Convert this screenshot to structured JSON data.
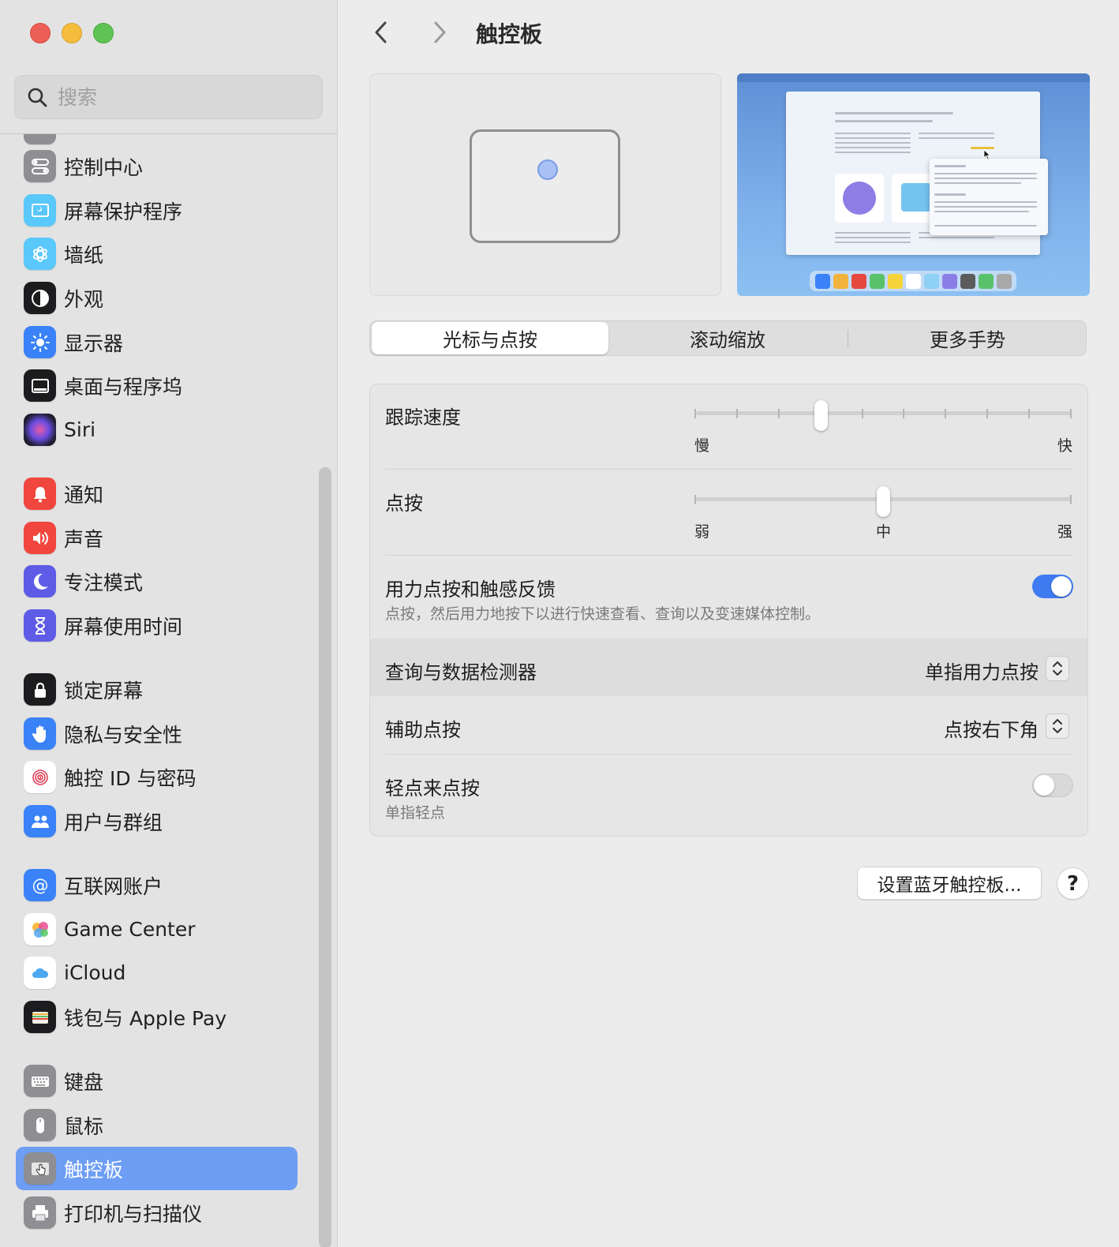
{
  "window": {
    "title": "触控板"
  },
  "sidebar": {
    "search_placeholder": "搜索",
    "items": [
      {
        "label": "控制中心",
        "icon": "control-center-icon",
        "color": "#8e8e93"
      },
      {
        "label": "屏幕保护程序",
        "icon": "screensaver-icon",
        "color": "#5ac8fa"
      },
      {
        "label": "墙纸",
        "icon": "wallpaper-icon",
        "color": "#5ac8fa"
      },
      {
        "label": "外观",
        "icon": "appearance-icon",
        "color": "#1c1c1e"
      },
      {
        "label": "显示器",
        "icon": "displays-icon",
        "color": "#3a82f7"
      },
      {
        "label": "桌面与程序坞",
        "icon": "desktop-dock-icon",
        "color": "#1c1c1e"
      },
      {
        "label": "Siri",
        "icon": "siri-icon",
        "color": "#2c2c3e"
      },
      {
        "label": "通知",
        "icon": "notifications-icon",
        "color": "#f0463e"
      },
      {
        "label": "声音",
        "icon": "sound-icon",
        "color": "#f0463e"
      },
      {
        "label": "专注模式",
        "icon": "focus-icon",
        "color": "#5e5ce6"
      },
      {
        "label": "屏幕使用时间",
        "icon": "screen-time-icon",
        "color": "#5e5ce6"
      },
      {
        "label": "锁定屏幕",
        "icon": "lock-screen-icon",
        "color": "#1c1c1e"
      },
      {
        "label": "隐私与安全性",
        "icon": "privacy-hand-icon",
        "color": "#3a82f7"
      },
      {
        "label": "触控 ID 与密码",
        "icon": "touch-id-icon",
        "color": "#ffffff"
      },
      {
        "label": "用户与群组",
        "icon": "users-groups-icon",
        "color": "#3a82f7"
      },
      {
        "label": "互联网账户",
        "icon": "internet-accounts-icon",
        "color": "#3a82f7"
      },
      {
        "label": "Game Center",
        "icon": "game-center-icon",
        "color": "#ffffff"
      },
      {
        "label": "iCloud",
        "icon": "icloud-icon",
        "color": "#ffffff"
      },
      {
        "label": "钱包与 Apple Pay",
        "icon": "wallet-icon",
        "color": "#1c1c1e"
      },
      {
        "label": "键盘",
        "icon": "keyboard-icon",
        "color": "#8e8e93"
      },
      {
        "label": "鼠标",
        "icon": "mouse-icon",
        "color": "#8e8e93"
      },
      {
        "label": "触控板",
        "icon": "trackpad-icon",
        "color": "#8e8e93",
        "active": true
      },
      {
        "label": "打印机与扫描仪",
        "icon": "printer-icon",
        "color": "#8e8e93"
      }
    ]
  },
  "tabs": [
    "光标与点按",
    "滚动缩放",
    "更多手势"
  ],
  "settings": {
    "tracking_speed": {
      "label": "跟踪速度",
      "min_label": "慢",
      "max_label": "快",
      "ticks": 10,
      "value_index": 3
    },
    "click": {
      "label": "点按",
      "min_label": "弱",
      "mid_label": "中",
      "max_label": "强",
      "value": 0.5
    },
    "force_click": {
      "label": "用力点按和触感反馈",
      "description": "点按，然后用力地按下以进行快速查看、查询以及变速媒体控制。",
      "on": true
    },
    "lookup": {
      "label": "查询与数据检测器",
      "value": "单指用力点按"
    },
    "secondary_click": {
      "label": "辅助点按",
      "value": "点按右下角"
    },
    "tap_to_click": {
      "label": "轻点来点按",
      "description": "单指轻点",
      "on": false
    }
  },
  "buttons": {
    "bluetooth_setup": "设置蓝牙触控板...",
    "help": "?"
  },
  "colors": {
    "accent": "#3f7bf0",
    "sidebar_selection": "#6d9ef4"
  }
}
